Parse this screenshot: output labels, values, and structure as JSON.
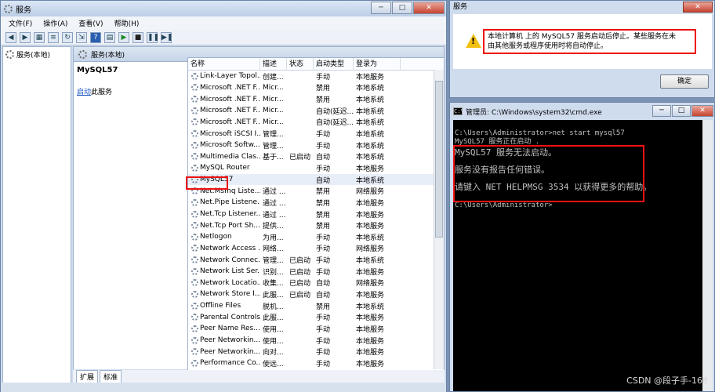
{
  "services_window": {
    "title": "服务",
    "menu": [
      "文件(F)",
      "操作(A)",
      "查看(V)",
      "帮助(H)"
    ],
    "tree_item": "服务(本地)",
    "pane_header": "服务(本地)",
    "selected_name": "MySQL57",
    "action_link": "启动",
    "action_suffix": "此服务",
    "columns": [
      "名称",
      "描述",
      "状态",
      "启动类型",
      "登录为"
    ],
    "rows": [
      [
        "Link-Layer Topol...",
        "创建...",
        "",
        "手动",
        "本地服务"
      ],
      [
        "Microsoft .NET F...",
        "Micr...",
        "",
        "禁用",
        "本地系统"
      ],
      [
        "Microsoft .NET F...",
        "Micr...",
        "",
        "禁用",
        "本地系统"
      ],
      [
        "Microsoft .NET F...",
        "Micr...",
        "",
        "自动(延迟...",
        "本地系统"
      ],
      [
        "Microsoft .NET F...",
        "Micr...",
        "",
        "自动(延迟...",
        "本地系统"
      ],
      [
        "Microsoft iSCSI I...",
        "管理...",
        "",
        "手动",
        "本地系统"
      ],
      [
        "Microsoft Softw...",
        "管理...",
        "",
        "手动",
        "本地系统"
      ],
      [
        "Multimedia Clas...",
        "基于...",
        "已启动",
        "自动",
        "本地系统"
      ],
      [
        "MySQL Router",
        "",
        "",
        "手动",
        "本地服务"
      ],
      [
        "MySQL57",
        "",
        "",
        "自动",
        "本地系统"
      ],
      [
        "Net.Msmq Liste...",
        "通过 ...",
        "",
        "禁用",
        "网络服务"
      ],
      [
        "Net.Pipe Listene...",
        "通过 ...",
        "",
        "禁用",
        "本地服务"
      ],
      [
        "Net.Tcp Listener...",
        "通过 ...",
        "",
        "禁用",
        "本地服务"
      ],
      [
        "Net.Tcp Port Sh...",
        "提供...",
        "",
        "禁用",
        "本地服务"
      ],
      [
        "Netlogon",
        "为用...",
        "",
        "手动",
        "本地系统"
      ],
      [
        "Network Access ...",
        "网络...",
        "",
        "手动",
        "网络服务"
      ],
      [
        "Network Connec...",
        "管理...",
        "已启动",
        "手动",
        "本地系统"
      ],
      [
        "Network List Ser...",
        "识别...",
        "已启动",
        "手动",
        "本地服务"
      ],
      [
        "Network Locatio...",
        "收集...",
        "已启动",
        "自动",
        "网络服务"
      ],
      [
        "Network Store I...",
        "此服...",
        "已启动",
        "自动",
        "本地服务"
      ],
      [
        "Offline Files",
        "脱机...",
        "",
        "禁用",
        "本地系统"
      ],
      [
        "Parental Controls",
        "此服...",
        "",
        "手动",
        "本地服务"
      ],
      [
        "Peer Name Res...",
        "使用...",
        "",
        "手动",
        "本地服务"
      ],
      [
        "Peer Networkin...",
        "使用...",
        "",
        "手动",
        "本地服务"
      ],
      [
        "Peer Networkin...",
        "向对...",
        "",
        "手动",
        "本地服务"
      ],
      [
        "Performance Co...",
        "使远...",
        "",
        "手动",
        "本地服务"
      ]
    ],
    "tabs": [
      "扩展",
      "标准"
    ]
  },
  "dialog": {
    "title": "服务",
    "message": "本地计算机 上的 MySQL57 服务启动后停止。某些服务在未由其他服务或程序使用时将自动停止。",
    "ok_label": "确定"
  },
  "cmd": {
    "title": "管理员: C:\\Windows\\system32\\cmd.exe",
    "line1": "C:\\Users\\Administrator>net start mysql57",
    "line2": "MySQL57 服务正在启动 .",
    "line3": "MySQL57 服务无法启动。",
    "line4": "服务没有报告任何错误。",
    "line5": "请键入 NET HELPMSG 3534 以获得更多的帮助。",
    "line6": "C:\\Users\\Administrator>"
  },
  "watermark": "CSDN @段子手-168"
}
